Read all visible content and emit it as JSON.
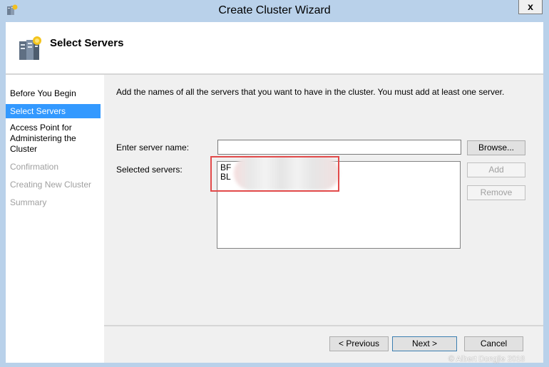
{
  "window": {
    "title": "Create Cluster Wizard",
    "close_label": "x"
  },
  "header": {
    "title": "Select Servers"
  },
  "nav": {
    "items": [
      {
        "label": "Before You Begin",
        "state": "normal"
      },
      {
        "label": "Select Servers",
        "state": "selected"
      },
      {
        "label": "Access Point for Administering the Cluster",
        "state": "normal"
      },
      {
        "label": "Confirmation",
        "state": "disabled"
      },
      {
        "label": "Creating New Cluster",
        "state": "disabled"
      },
      {
        "label": "Summary",
        "state": "disabled"
      }
    ]
  },
  "main": {
    "instructions": "Add the names of all the servers that you want to have in the cluster. You must add at least one server.",
    "server_name_label": "Enter server name:",
    "server_name_value": "",
    "selected_label": "Selected servers:",
    "selected_servers": [
      "BF",
      "BL"
    ],
    "browse_label": "Browse...",
    "add_label": "Add",
    "remove_label": "Remove"
  },
  "footer": {
    "previous_label": "< Previous",
    "next_label": "Next >",
    "cancel_label": "Cancel"
  },
  "watermark": "© Albert Dongjie 2018",
  "colors": {
    "titlebar": "#b9d1ea",
    "selection": "#3399ff",
    "highlight_box": "#e24a4a"
  }
}
